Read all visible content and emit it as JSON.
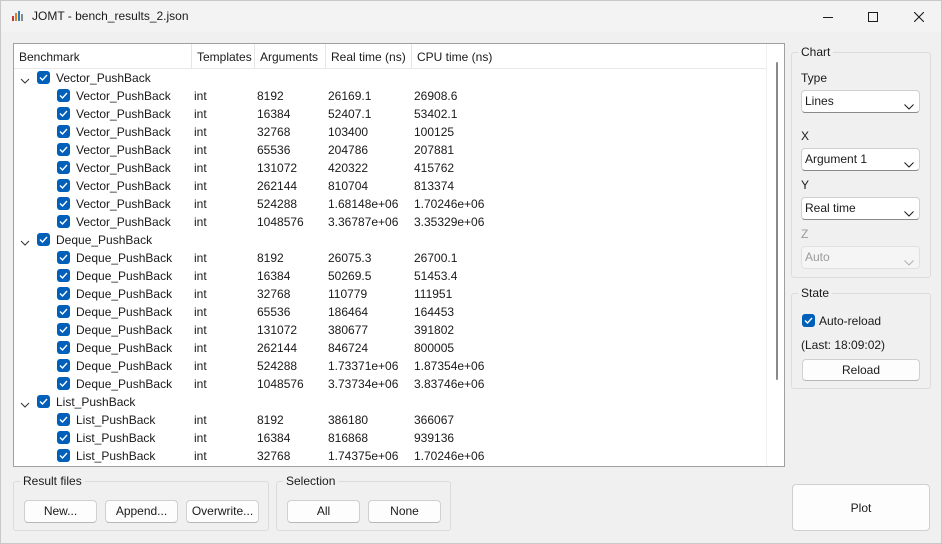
{
  "window": {
    "title": "JOMT - bench_results_2.json",
    "minimize_icon": "minimize-icon",
    "maximize_icon": "maximize-icon",
    "close_icon": "close-icon",
    "app_icon": "chart-app-icon"
  },
  "tree": {
    "columns": [
      "Benchmark",
      "Templates",
      "Arguments",
      "Real time (ns)",
      "CPU time (ns)"
    ],
    "groups": [
      {
        "name": "Vector_PushBack",
        "checked": true,
        "rows": [
          {
            "name": "Vector_PushBack",
            "template": "int",
            "argument": "8192",
            "real": "26169.1",
            "cpu": "26908.6"
          },
          {
            "name": "Vector_PushBack",
            "template": "int",
            "argument": "16384",
            "real": "52407.1",
            "cpu": "53402.1"
          },
          {
            "name": "Vector_PushBack",
            "template": "int",
            "argument": "32768",
            "real": "103400",
            "cpu": "100125"
          },
          {
            "name": "Vector_PushBack",
            "template": "int",
            "argument": "65536",
            "real": "204786",
            "cpu": "207881"
          },
          {
            "name": "Vector_PushBack",
            "template": "int",
            "argument": "131072",
            "real": "420322",
            "cpu": "415762"
          },
          {
            "name": "Vector_PushBack",
            "template": "int",
            "argument": "262144",
            "real": "810704",
            "cpu": "813374"
          },
          {
            "name": "Vector_PushBack",
            "template": "int",
            "argument": "524288",
            "real": "1.68148e+06",
            "cpu": "1.70246e+06"
          },
          {
            "name": "Vector_PushBack",
            "template": "int",
            "argument": "1048576",
            "real": "3.36787e+06",
            "cpu": "3.35329e+06"
          }
        ]
      },
      {
        "name": "Deque_PushBack",
        "checked": true,
        "rows": [
          {
            "name": "Deque_PushBack",
            "template": "int",
            "argument": "8192",
            "real": "26075.3",
            "cpu": "26700.1"
          },
          {
            "name": "Deque_PushBack",
            "template": "int",
            "argument": "16384",
            "real": "50269.5",
            "cpu": "51453.4"
          },
          {
            "name": "Deque_PushBack",
            "template": "int",
            "argument": "32768",
            "real": "110779",
            "cpu": "111951"
          },
          {
            "name": "Deque_PushBack",
            "template": "int",
            "argument": "65536",
            "real": "186464",
            "cpu": "164453"
          },
          {
            "name": "Deque_PushBack",
            "template": "int",
            "argument": "131072",
            "real": "380677",
            "cpu": "391802"
          },
          {
            "name": "Deque_PushBack",
            "template": "int",
            "argument": "262144",
            "real": "846724",
            "cpu": "800005"
          },
          {
            "name": "Deque_PushBack",
            "template": "int",
            "argument": "524288",
            "real": "1.73371e+06",
            "cpu": "1.87354e+06"
          },
          {
            "name": "Deque_PushBack",
            "template": "int",
            "argument": "1048576",
            "real": "3.73734e+06",
            "cpu": "3.83746e+06"
          }
        ]
      },
      {
        "name": "List_PushBack",
        "checked": true,
        "rows": [
          {
            "name": "List_PushBack",
            "template": "int",
            "argument": "8192",
            "real": "386180",
            "cpu": "366067"
          },
          {
            "name": "List_PushBack",
            "template": "int",
            "argument": "16384",
            "real": "816868",
            "cpu": "939136"
          },
          {
            "name": "List_PushBack",
            "template": "int",
            "argument": "32768",
            "real": "1.74375e+06",
            "cpu": "1.70246e+06"
          }
        ]
      }
    ]
  },
  "result_files": {
    "title": "Result files",
    "new": "New...",
    "append": "Append...",
    "overwrite": "Overwrite..."
  },
  "selection": {
    "title": "Selection",
    "all": "All",
    "none": "None"
  },
  "chart": {
    "title": "Chart",
    "type_label": "Type",
    "type_value": "Lines",
    "x_label": "X",
    "x_value": "Argument 1",
    "y_label": "Y",
    "y_value": "Real time",
    "z_label": "Z",
    "z_value": "Auto"
  },
  "state": {
    "title": "State",
    "auto_reload_label": "Auto-reload",
    "auto_reload_checked": true,
    "last_reload": "(Last: 18:09:02)",
    "reload": "Reload"
  },
  "plot": "Plot",
  "colors": {
    "accent": "#005fb8"
  }
}
